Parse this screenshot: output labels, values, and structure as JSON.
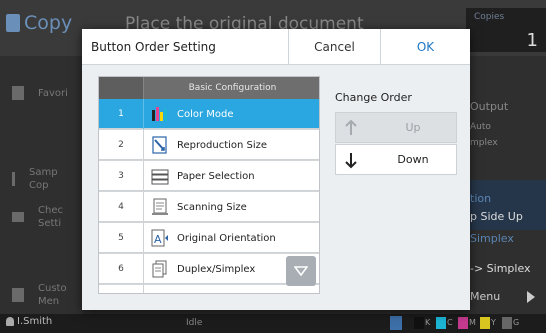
{
  "background": {
    "app_title": "Copy",
    "top_message": "Place the original document",
    "copies_label": "Copies",
    "copies_value": "1",
    "left_items": [
      {
        "label": "Favori",
        "icon": "favorite-icon"
      },
      {
        "label": "Samp\nCop",
        "icon": "sample-copy-icon"
      },
      {
        "label": "Chec\nSetti",
        "icon": "check-settings-icon"
      },
      {
        "label": "Custo\nMen",
        "icon": "custom-menu-icon"
      }
    ],
    "right_items": {
      "output": "Output",
      "auto": "Auto",
      "simplex": "mplex",
      "tion": "tion",
      "side_up": "p Side Up",
      "simplex2": "Simplex",
      "to_simplex": "-> Simplex",
      "menu": "Menu"
    },
    "status_user": "I.Smith",
    "status_idle": "Idle",
    "ink": [
      "K",
      "C",
      "M",
      "Y",
      "G"
    ]
  },
  "dialog": {
    "title": "Button Order Setting",
    "cancel_label": "Cancel",
    "ok_label": "OK",
    "list_header": "Basic Configuration",
    "rows": [
      {
        "num": "1",
        "label": "Color Mode",
        "icon": "color-mode-icon",
        "selected": true
      },
      {
        "num": "2",
        "label": "Reproduction Size",
        "icon": "reproduction-size-icon",
        "selected": false
      },
      {
        "num": "3",
        "label": "Paper Selection",
        "icon": "paper-selection-icon",
        "selected": false
      },
      {
        "num": "4",
        "label": "Scanning Size",
        "icon": "scanning-size-icon",
        "selected": false
      },
      {
        "num": "5",
        "label": "Original Orientation",
        "icon": "original-orientation-icon",
        "selected": false
      },
      {
        "num": "6",
        "label": "Duplex/Simplex",
        "icon": "duplex-simplex-icon",
        "selected": false
      }
    ],
    "change_order_label": "Change Order",
    "up_label": "Up",
    "down_label": "Down"
  },
  "colors": {
    "accent": "#2aa6e0",
    "ok": "#1d78c4"
  }
}
